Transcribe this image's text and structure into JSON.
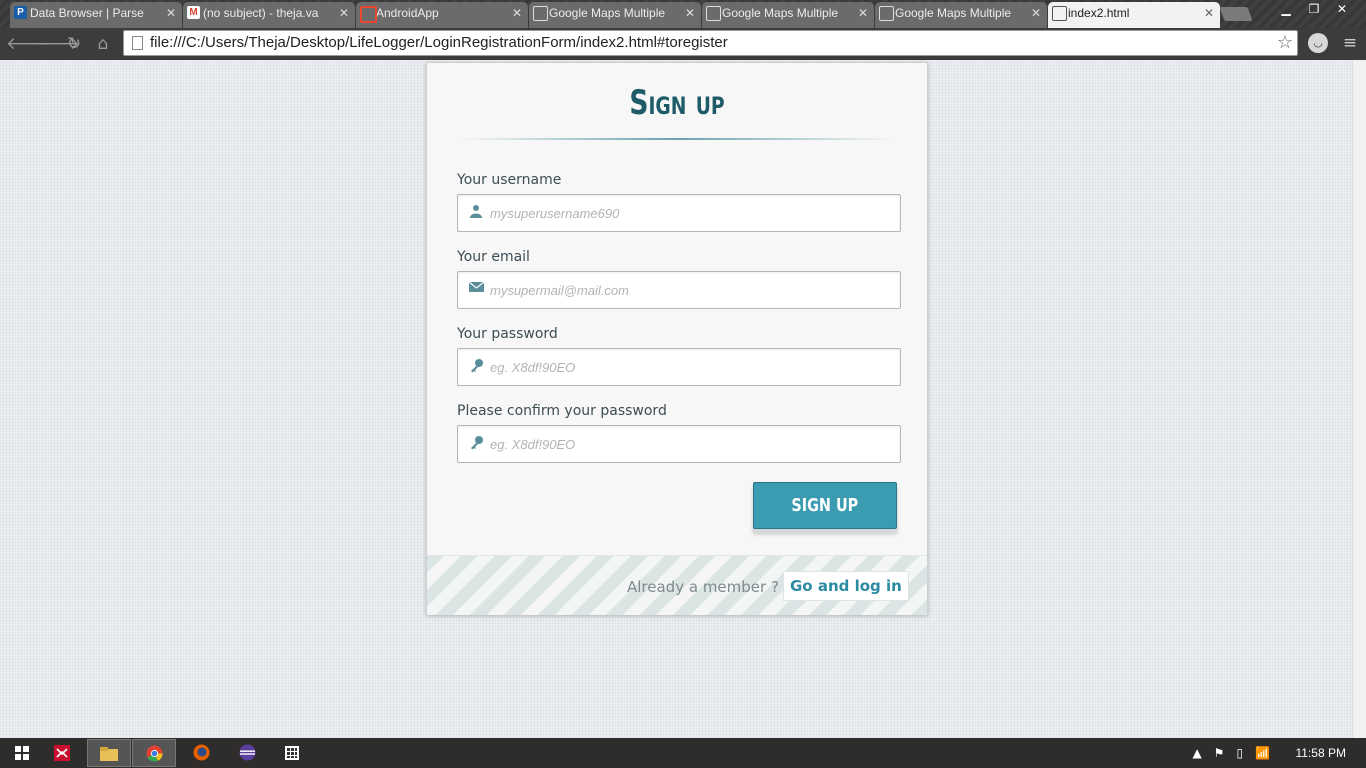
{
  "browser": {
    "tabs": [
      {
        "title": "Data Browser | Parse",
        "icon": "parse-icon"
      },
      {
        "title": "(no subject) - theja.va",
        "icon": "gmail-icon"
      },
      {
        "title": "AndroidApp",
        "icon": "android-app-icon"
      },
      {
        "title": "Google Maps Multiple",
        "icon": "document-icon"
      },
      {
        "title": "Google Maps Multiple",
        "icon": "document-icon"
      },
      {
        "title": "Google Maps Multiple",
        "icon": "document-icon"
      },
      {
        "title": "index2.html",
        "icon": "document-icon",
        "active": true
      }
    ],
    "url": "file:///C:/Users/Theja/Desktop/LifeLogger/LoginRegistrationForm/index2.html#toregister"
  },
  "form": {
    "title": "Sign up",
    "fields": [
      {
        "label": "Your username",
        "placeholder": "mysuperusername690",
        "icon": "user-icon"
      },
      {
        "label": "Your email",
        "placeholder": "mysupermail@mail.com",
        "icon": "envelope-icon"
      },
      {
        "label": "Your password",
        "placeholder": "eg. X8df!90EO",
        "icon": "key-icon"
      },
      {
        "label": "Please confirm your password",
        "placeholder": "eg. X8df!90EO",
        "icon": "key-icon"
      }
    ],
    "submit_label": "SIGN UP",
    "footer": {
      "member_text": "Already a member ?",
      "login_link": "Go and log in"
    }
  },
  "taskbar": {
    "clock": "11:58 PM"
  },
  "colors": {
    "accent": "#3b9bb1",
    "title": "#1d5b69",
    "link": "#2c8aa3"
  }
}
